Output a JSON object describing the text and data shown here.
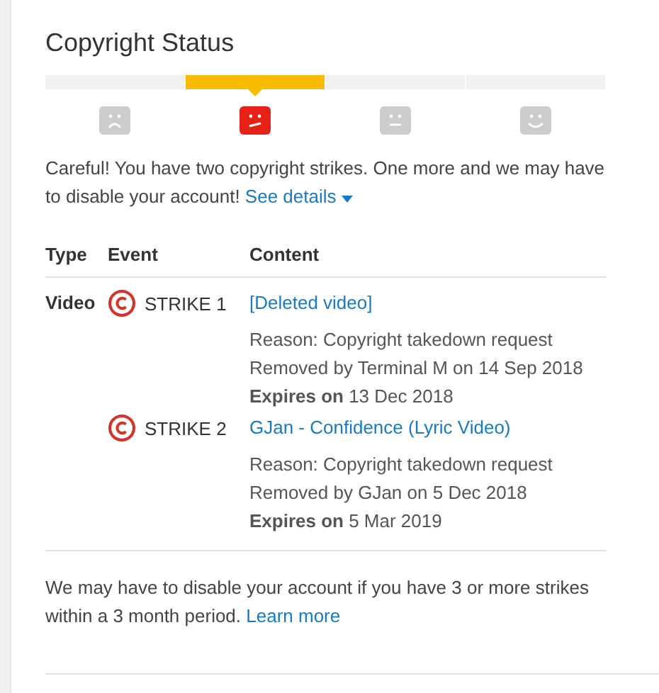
{
  "title": "Copyright Status",
  "stages": [
    {
      "kind": "frown",
      "selected": false
    },
    {
      "kind": "strike",
      "selected": true
    },
    {
      "kind": "neutral",
      "selected": false
    },
    {
      "kind": "smile",
      "selected": false
    }
  ],
  "warning": {
    "text": "Careful! You have two copyright strikes. One more and we may have to disable your account!",
    "link": "See details"
  },
  "table": {
    "columns": [
      "Type",
      "Event",
      "Content"
    ],
    "rows": [
      {
        "type": "Video",
        "event": "STRIKE  1",
        "content": "[Deleted video]",
        "reason": "Reason: Copyright takedown request",
        "removed": "Removed by Terminal M on 14 Sep 2018",
        "expires": "**Expires on** 13 Dec 2018"
      },
      {
        "event": "STRIKE  2",
        "content": "GJan - Confidence (Lyric Video)",
        "reason": "Reason: Copyright takedown request",
        "removed": "Removed by GJan on 5 Dec 2018",
        "expires": "**Expires on** 5 Mar 2019"
      }
    ]
  },
  "footer": {
    "text": "We may have to disable your account if you have 3 or more strikes within a 3 month period.",
    "link": "Learn more"
  }
}
